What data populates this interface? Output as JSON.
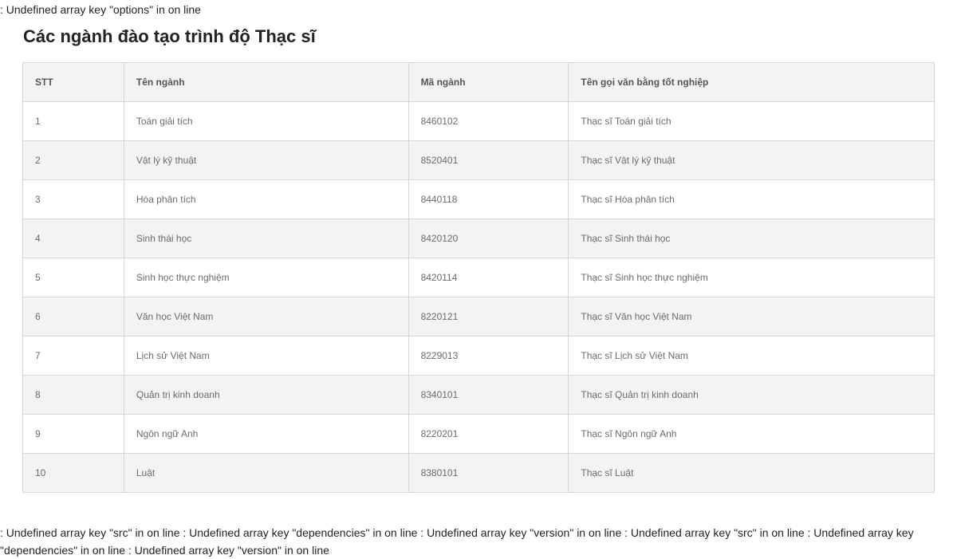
{
  "notices": {
    "top": ": Undefined array key \"options\" in on line",
    "bottom": ": Undefined array key \"src\" in on line : Undefined array key \"dependencies\" in on line : Undefined array key \"version\" in on line : Undefined array key \"src\" in on line : Undefined array key \"dependencies\" in on line : Undefined array key \"version\" in on line"
  },
  "page": {
    "title": "Các ngành đào tạo trình độ Thạc sĩ"
  },
  "table": {
    "headers": {
      "stt": "STT",
      "name": "Tên ngành",
      "code": "Mã ngành",
      "degree": "Tên gọi văn bằng tốt nghiệp"
    },
    "rows": [
      {
        "stt": "1",
        "name": "Toán giải tích",
        "code": "8460102",
        "degree": "Thạc sĩ Toán giải tích"
      },
      {
        "stt": "2",
        "name": "Vật lý kỹ thuật",
        "code": "8520401",
        "degree": "Thạc sĩ Vật lý kỹ thuật"
      },
      {
        "stt": "3",
        "name": "Hóa phân tích",
        "code": "8440118",
        "degree": "Thạc sĩ Hóa phân tích"
      },
      {
        "stt": "4",
        "name": "Sinh thái học",
        "code": "8420120",
        "degree": "Thạc sĩ Sinh thái học"
      },
      {
        "stt": "5",
        "name": "Sinh học thực nghiệm",
        "code": "8420114",
        "degree": "Thạc sĩ Sinh học thực nghiệm"
      },
      {
        "stt": "6",
        "name": "Văn học Việt Nam",
        "code": "8220121",
        "degree": "Thạc sĩ Văn học Việt Nam"
      },
      {
        "stt": "7",
        "name": "Lịch sử Việt Nam",
        "code": "8229013",
        "degree": "Thạc sĩ Lịch sử Việt Nam"
      },
      {
        "stt": "8",
        "name": "Quản trị kinh doanh",
        "code": "8340101",
        "degree": "Thạc sĩ Quản trị kinh doanh"
      },
      {
        "stt": "9",
        "name": "Ngôn ngữ Anh",
        "code": "8220201",
        "degree": "Thạc sĩ Ngôn ngữ Anh"
      },
      {
        "stt": "10",
        "name": "Luật",
        "code": "8380101",
        "degree": "Thạc sĩ Luật"
      }
    ]
  }
}
